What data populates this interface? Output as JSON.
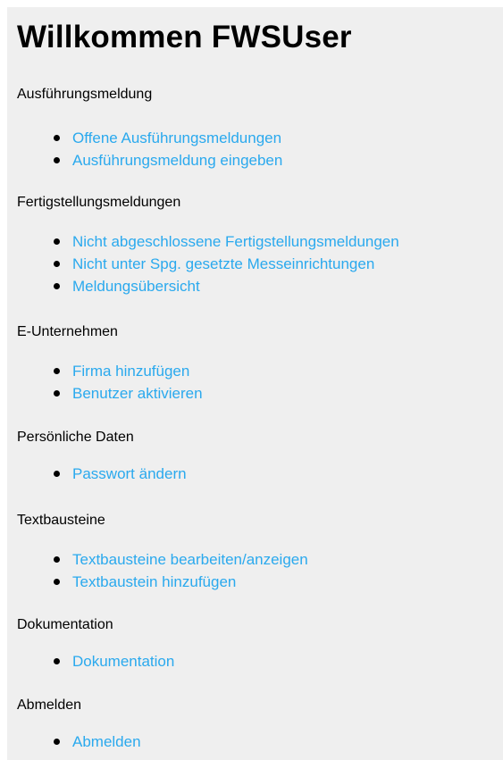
{
  "page": {
    "title": "Willkommen FWSUser"
  },
  "sections": [
    {
      "heading": "Ausführungsmeldung",
      "links": [
        "Offene Ausführungsmeldungen",
        "Ausführungsmeldung eingeben"
      ]
    },
    {
      "heading": "Fertigstellungsmeldungen",
      "links": [
        "Nicht abgeschlossene Fertigstellungsmeldungen",
        "Nicht unter Spg. gesetzte Messeinrichtungen",
        "Meldungsübersicht"
      ]
    },
    {
      "heading": "E-Unternehmen",
      "links": [
        "Firma hinzufügen",
        "Benutzer aktivieren"
      ]
    },
    {
      "heading": "Persönliche Daten",
      "links": [
        "Passwort ändern"
      ]
    },
    {
      "heading": "Textbausteine",
      "links": [
        "Textbausteine bearbeiten/anzeigen",
        "Textbaustein hinzufügen"
      ]
    },
    {
      "heading": "Dokumentation",
      "links": [
        "Dokumentation"
      ]
    },
    {
      "heading": "Abmelden",
      "links": [
        "Abmelden"
      ]
    }
  ],
  "colors": {
    "link": "#2aa9ee",
    "panel_background": "#efefef",
    "text": "#000000"
  },
  "icons": {
    "bullet": "bullet-icon"
  }
}
